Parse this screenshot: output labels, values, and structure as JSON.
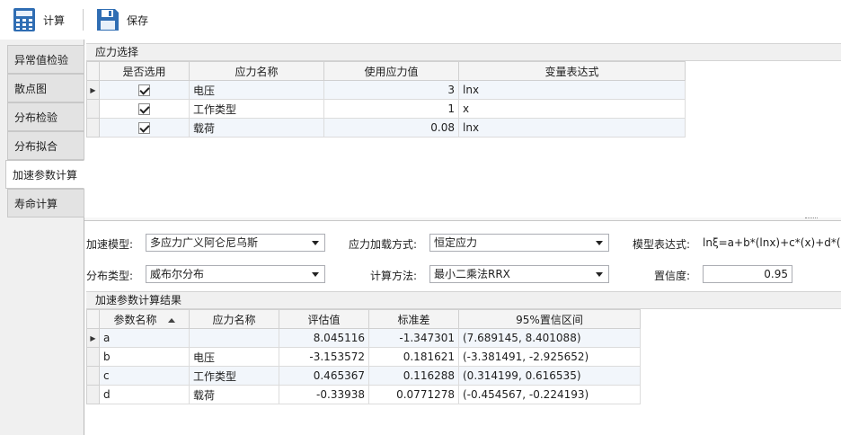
{
  "toolbar": {
    "calc_label": "计算",
    "save_label": "保存"
  },
  "nav": {
    "items": [
      {
        "label": "异常值检验"
      },
      {
        "label": "散点图"
      },
      {
        "label": "分布检验"
      },
      {
        "label": "分布拟合"
      },
      {
        "label": "加速参数计算"
      },
      {
        "label": "寿命计算"
      }
    ],
    "active": "加速参数计算"
  },
  "stress": {
    "title": "应力选择",
    "columns": [
      "是否选用",
      "应力名称",
      "使用应力值",
      "变量表达式"
    ],
    "rows": [
      {
        "checked": true,
        "name": "电压",
        "value": "3",
        "expr": "lnx"
      },
      {
        "checked": true,
        "name": "工作类型",
        "value": "1",
        "expr": "x"
      },
      {
        "checked": true,
        "name": "载荷",
        "value": "0.08",
        "expr": "lnx"
      }
    ]
  },
  "form": {
    "accel_model_label": "加速模型:",
    "accel_model_value": "多应力广义阿仑尼乌斯",
    "load_mode_label": "应力加载方式:",
    "load_mode_value": "恒定应力",
    "model_expr_label": "模型表达式:",
    "model_expr_value": "lnξ=a+b*(lnx)+c*(x)+d*(lnx)",
    "dist_type_label": "分布类型:",
    "dist_type_value": "威布尔分布",
    "calc_method_label": "计算方法:",
    "calc_method_value": "最小二乘法RRX",
    "confidence_label": "置信度:",
    "confidence_value": "0.95"
  },
  "results": {
    "title": "加速参数计算结果",
    "columns": [
      "参数名称",
      "应力名称",
      "评估值",
      "标准差",
      "95%置信区间"
    ],
    "rows": [
      {
        "param": "a",
        "stress": "",
        "estimate": "8.045116",
        "std": "-1.347301",
        "ci": "(7.689145, 8.401088)"
      },
      {
        "param": "b",
        "stress": "电压",
        "estimate": "-3.153572",
        "std": "0.181621",
        "ci": "(-3.381491, -2.925652)"
      },
      {
        "param": "c",
        "stress": "工作类型",
        "estimate": "0.465367",
        "std": "0.116288",
        "ci": "(0.314199, 0.616535)"
      },
      {
        "param": "d",
        "stress": "载荷",
        "estimate": "-0.33938",
        "std": "0.0771278",
        "ci": "(-0.454567, -0.224193)"
      }
    ]
  },
  "colors": {
    "accent_icon": "#2f6db3",
    "panel_header": "#f0f0f0",
    "row_alt": "#f2f6fb"
  }
}
